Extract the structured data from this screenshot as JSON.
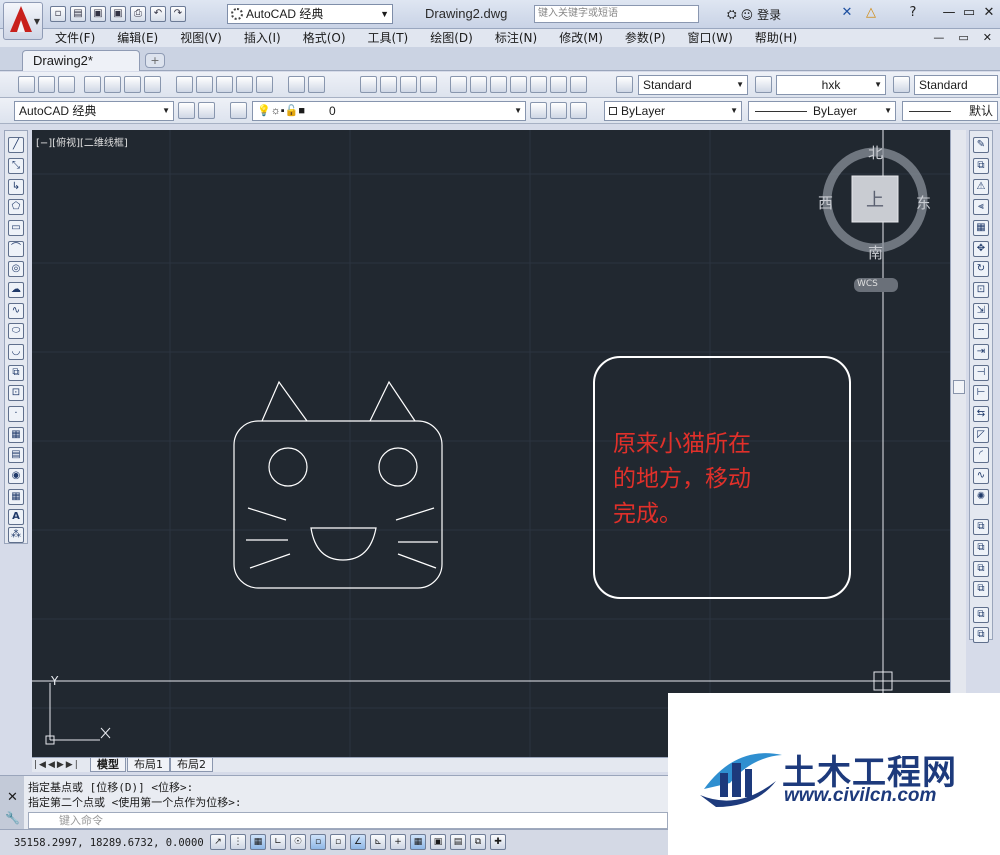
{
  "title_bar": {
    "workspace": "AutoCAD 经典",
    "document": "Drawing2.dwg",
    "search_placeholder": "键入关键字或短语",
    "login": "登录",
    "help": "?",
    "min": "—",
    "restore": "▭",
    "close": "✕"
  },
  "menu": [
    "文件(F)",
    "编辑(E)",
    "视图(V)",
    "插入(I)",
    "格式(O)",
    "工具(T)",
    "绘图(D)",
    "标注(N)",
    "修改(M)",
    "参数(P)",
    "窗口(W)",
    "帮助(H)"
  ],
  "tabs": {
    "active": "Drawing2*",
    "new": "+"
  },
  "toolbar1": {
    "text_style": "Standard",
    "dim_style": "hxk",
    "table_style": "Standard"
  },
  "toolbar2": {
    "workspace": "AutoCAD 经典",
    "layer": "0",
    "color": "ByLayer",
    "linetype": "ByLayer",
    "lineweight": "默认"
  },
  "viewport": {
    "label": "[−][俯视][二维线框]",
    "compass": {
      "north": "北",
      "south": "南",
      "east": "东",
      "west": "西",
      "face": "上",
      "ucs": "WCS"
    },
    "annotation": [
      "原来小猫所在",
      "的地方，移动",
      "完成。"
    ],
    "ucs_y": "Y"
  },
  "layout_tabs": [
    "模型",
    "布局1",
    "布局2"
  ],
  "command": {
    "line1": "指定基点或 [位移(D)] <位移>:",
    "line2": "指定第二个点或 <使用第一个点作为位移>:",
    "placeholder": "键入命令"
  },
  "status": {
    "coords": "35158.2997, 18289.6732, 0.0000"
  },
  "watermark": {
    "name": "土木工程网",
    "url": "www.civilcn.com"
  },
  "colors": {
    "canvas": "#212830",
    "annotation": "#e0302a",
    "linework": "#ffffff",
    "brand": "#1d3a7c"
  }
}
